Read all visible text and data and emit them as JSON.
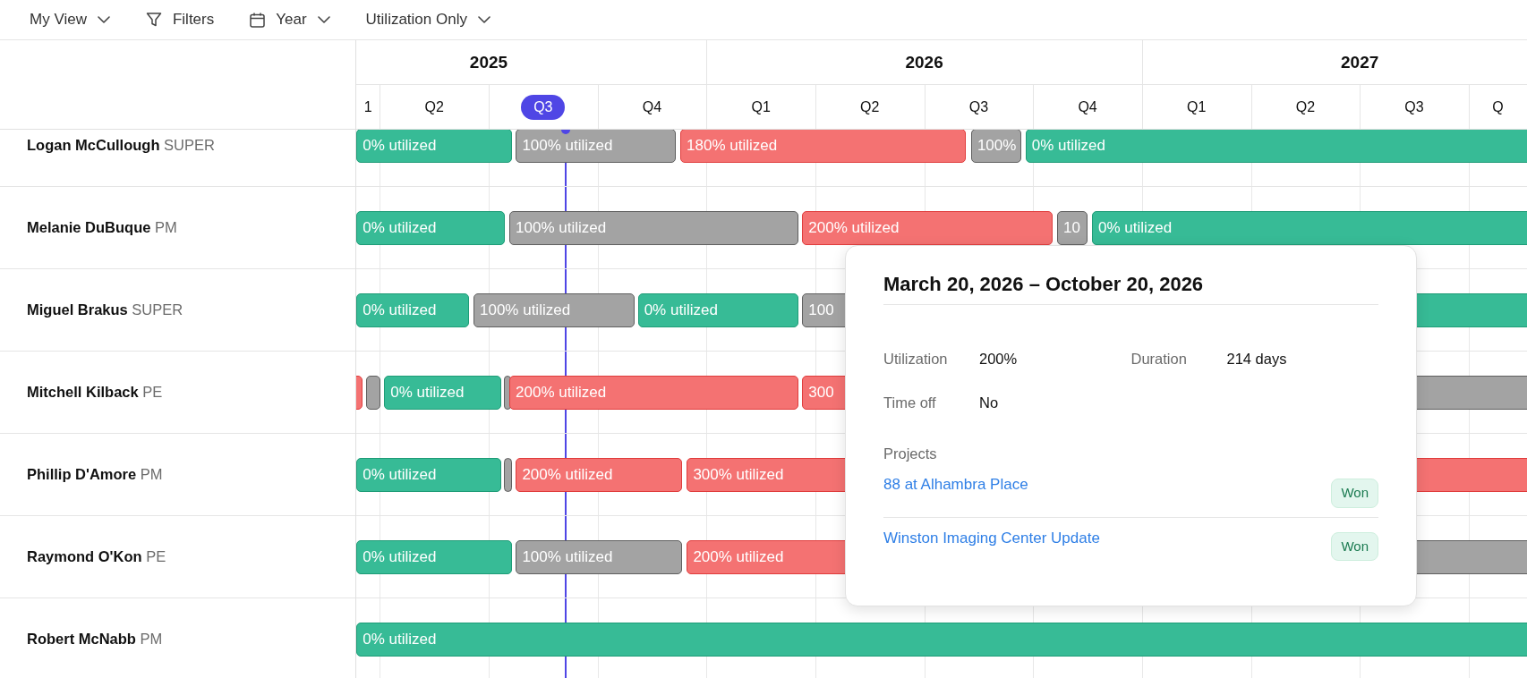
{
  "toolbar": [
    {
      "kind": "dropdown",
      "label": "My View"
    },
    {
      "kind": "filter",
      "label": "Filters"
    },
    {
      "kind": "calendar",
      "label": "Year"
    },
    {
      "kind": "dropdown",
      "label": "Utilization Only"
    }
  ],
  "timeline": {
    "years": [
      {
        "label": "2025",
        "quarters": [
          {
            "label": "1",
            "selected": false
          },
          {
            "label": "Q2",
            "selected": false
          },
          {
            "label": "Q3",
            "selected": true
          },
          {
            "label": "Q4",
            "selected": false
          }
        ]
      },
      {
        "label": "2026",
        "quarters": [
          {
            "label": "Q1",
            "selected": false
          },
          {
            "label": "Q2",
            "selected": false
          },
          {
            "label": "Q3",
            "selected": false
          },
          {
            "label": "Q4",
            "selected": false
          }
        ]
      },
      {
        "label": "2027",
        "quarters": [
          {
            "label": "Q1",
            "selected": false
          },
          {
            "label": "Q2",
            "selected": false
          },
          {
            "label": "Q3",
            "selected": false
          },
          {
            "label": "Q",
            "selected": false
          }
        ]
      }
    ]
  },
  "people": [
    {
      "name": "Logan McCullough",
      "role": "SUPER",
      "bars": [
        {
          "kind": "free",
          "label": "0% utilized"
        },
        {
          "kind": "full",
          "label": "100% utilized"
        },
        {
          "kind": "over",
          "label": "180% utilized"
        },
        {
          "kind": "full",
          "label": "100%"
        },
        {
          "kind": "free",
          "label": "0% utilized"
        }
      ]
    },
    {
      "name": "Melanie DuBuque",
      "role": "PM",
      "bars": [
        {
          "kind": "free",
          "label": "0% utilized"
        },
        {
          "kind": "full",
          "label": "100% utilized"
        },
        {
          "kind": "over",
          "label": "200% utilized"
        },
        {
          "kind": "full",
          "label": "10"
        },
        {
          "kind": "free",
          "label": "0% utilized"
        }
      ]
    },
    {
      "name": "Miguel Brakus",
      "role": "SUPER",
      "bars": [
        {
          "kind": "free",
          "label": "0% utilized"
        },
        {
          "kind": "full",
          "label": "100% utilized"
        },
        {
          "kind": "free",
          "label": "0% utilized"
        },
        {
          "kind": "full",
          "label": "100"
        },
        {
          "kind": "free"
        }
      ]
    },
    {
      "name": "Mitchell Kilback",
      "role": "PE",
      "bars": [
        {
          "kind": "over"
        },
        {
          "kind": "full"
        },
        {
          "kind": "free",
          "label": "0% utilized"
        },
        {
          "kind": "full"
        },
        {
          "kind": "over",
          "label": "200% utilized"
        },
        {
          "kind": "over",
          "label": "300"
        },
        {
          "kind": "full"
        }
      ]
    },
    {
      "name": "Phillip D'Amore",
      "role": "PM",
      "bars": [
        {
          "kind": "free",
          "label": "0% utilized"
        },
        {
          "kind": "full"
        },
        {
          "kind": "over",
          "label": "200% utilized"
        },
        {
          "kind": "over",
          "label": "300% utilized"
        }
      ]
    },
    {
      "name": "Raymond O'Kon",
      "role": "PE",
      "bars": [
        {
          "kind": "free",
          "label": "0% utilized"
        },
        {
          "kind": "full",
          "label": "100% utilized"
        },
        {
          "kind": "over",
          "label": "200% utilized"
        },
        {
          "kind": "full"
        }
      ]
    },
    {
      "name": "Robert McNabb",
      "role": "PM",
      "bars": [
        {
          "kind": "free",
          "label": "0% utilized"
        }
      ]
    }
  ],
  "tooltip": {
    "title": "March 20, 2026 – October 20, 2026",
    "details": [
      {
        "label": "Utilization",
        "value": "200%"
      },
      {
        "label": "Duration",
        "value": "214 days"
      },
      {
        "label": "Time off",
        "value": "No"
      }
    ],
    "projects_label": "Projects",
    "projects": [
      {
        "name": "88 at Alhambra Place",
        "status": "Won"
      },
      {
        "name": "Winston Imaging Center Update",
        "status": "Won"
      }
    ]
  }
}
